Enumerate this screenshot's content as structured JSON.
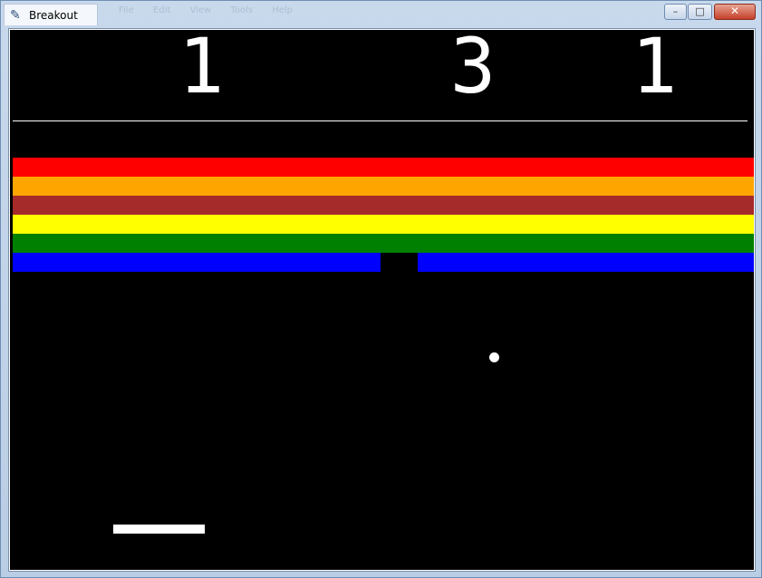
{
  "window": {
    "title": "Breakout",
    "menu_items": [
      "File",
      "Edit",
      "View",
      "Tools",
      "Help"
    ],
    "controls": {
      "minimize": "–",
      "maximize": "□",
      "close": "✕"
    }
  },
  "game": {
    "background": "#000000",
    "scores": [
      "1",
      "3",
      "1"
    ],
    "brick_rows": [
      {
        "color": "#ff0000",
        "bricks": 1
      },
      {
        "color": "#ffa500",
        "bricks": 1
      },
      {
        "color": "#a52a2a",
        "bricks": 1
      },
      {
        "color": "#ffff00",
        "bricks": 1
      },
      {
        "color": "#008000",
        "bricks": 1
      },
      {
        "color": "#0000ff",
        "bricks": 2
      }
    ],
    "ball_color": "#ffffff",
    "paddle_color": "#ffffff"
  }
}
